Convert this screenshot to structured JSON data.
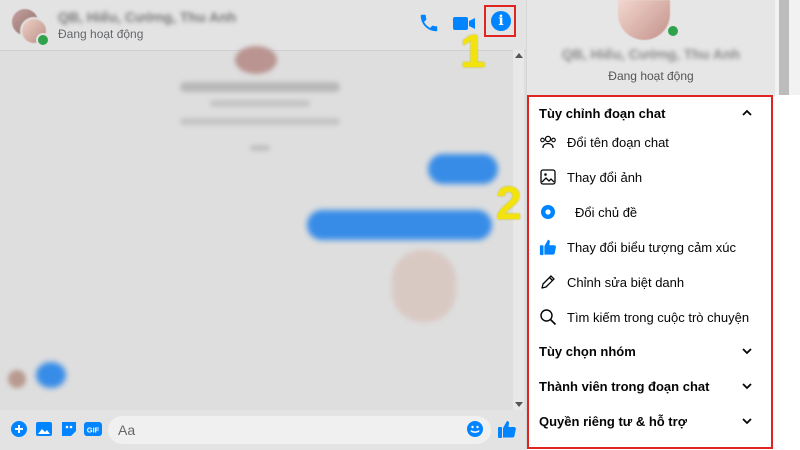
{
  "chat": {
    "header": {
      "name": "QB, Hiếu, Cường, Thu Anh",
      "status": "Đang hoạt động"
    },
    "composer": {
      "placeholder": "Aa",
      "gif_label": "GIF"
    }
  },
  "markers": {
    "first": "1",
    "second": "2"
  },
  "panel": {
    "name": "QB, Hiếu, Cường, Thu Anh",
    "status": "Đang hoạt động",
    "section_customize": "Tùy chỉnh đoạn chat",
    "items": [
      {
        "label": "Đổi tên đoạn chat",
        "icon": "people-icon"
      },
      {
        "label": "Thay đổi ảnh",
        "icon": "image-icon"
      },
      {
        "label": "Đổi chủ đề",
        "icon": "theme-icon"
      },
      {
        "label": "Thay đổi biểu tượng cảm xúc",
        "icon": "thumbs-up-icon"
      },
      {
        "label": "Chỉnh sửa biệt danh",
        "icon": "pencil-icon"
      },
      {
        "label": "Tìm kiếm trong cuộc trò chuyện",
        "icon": "search-icon"
      }
    ],
    "section_group": "Tùy chọn nhóm",
    "section_members": "Thành viên trong đoạn chat",
    "section_privacy": "Quyền riêng tư & hỗ trợ"
  },
  "colors": {
    "accent": "#0084ff",
    "highlight_border": "#e02424",
    "marker": "#f2e30f",
    "online": "#31a24c"
  }
}
